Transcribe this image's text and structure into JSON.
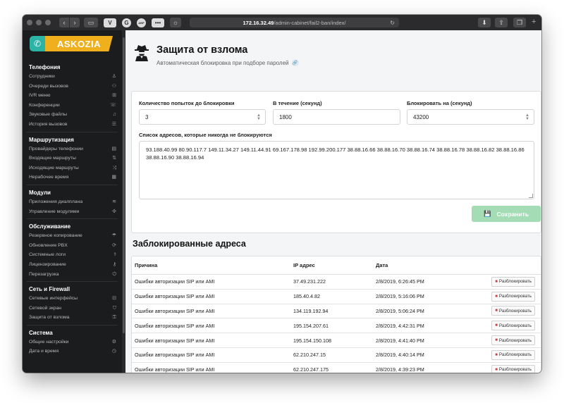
{
  "browser": {
    "url_host": "172.16.32.49",
    "url_path": "/admin-cabinet/fail2-ban/index/",
    "ext_v": "V",
    "ext_g": "G",
    "ext_abp": "ABP",
    "ext_dots": "•••"
  },
  "logo": {
    "text": "ASKOZIA"
  },
  "sidebar": {
    "sections": [
      {
        "title": "Телефония",
        "items": [
          {
            "label": "Сотрудники",
            "icon": "user-icon"
          },
          {
            "label": "Очереди вызовов",
            "icon": "users-icon"
          },
          {
            "label": "IVR меню",
            "icon": "sitemap-icon"
          },
          {
            "label": "Конференции",
            "icon": "phone-volume-icon"
          },
          {
            "label": "Звуковые файлы",
            "icon": "music-icon"
          },
          {
            "label": "История вызовов",
            "icon": "list-icon"
          }
        ]
      },
      {
        "title": "Маршрутизация",
        "items": [
          {
            "label": "Провайдеры телефонии",
            "icon": "server-icon"
          },
          {
            "label": "Входящие маршруты",
            "icon": "arrows-icon"
          },
          {
            "label": "Исходящие маршруты",
            "icon": "random-icon"
          },
          {
            "label": "Нерабочее время",
            "icon": "calendar-icon"
          }
        ]
      },
      {
        "title": "Модули",
        "items": [
          {
            "label": "Приложения диалплана",
            "icon": "code-icon"
          },
          {
            "label": "Управление модулями",
            "icon": "puzzle-icon"
          }
        ]
      },
      {
        "title": "Обслуживание",
        "items": [
          {
            "label": "Резервное копирование",
            "icon": "umbrella-icon"
          },
          {
            "label": "Обновление PBX",
            "icon": "sync-icon"
          },
          {
            "label": "Системные логи",
            "icon": "stethoscope-icon"
          },
          {
            "label": "Лицензирование",
            "icon": "key-icon"
          },
          {
            "label": "Перезагрузка",
            "icon": "power-icon"
          }
        ]
      },
      {
        "title": "Сеть и Firewall",
        "items": [
          {
            "label": "Сетевые интерфейсы",
            "icon": "network-icon"
          },
          {
            "label": "Сетевой экран",
            "icon": "shield-icon"
          },
          {
            "label": "Защита от взлома",
            "icon": "lock-icon"
          }
        ]
      },
      {
        "title": "Система",
        "items": [
          {
            "label": "Общие настройки",
            "icon": "cogs-icon"
          },
          {
            "label": "Дата и время",
            "icon": "clock-icon"
          }
        ]
      }
    ]
  },
  "header": {
    "title": "Защита от взлома",
    "subtitle": "Автоматическая блокировка при подборе паролей"
  },
  "form": {
    "attempts_label": "Количество попыток до блокировки",
    "attempts_value": "3",
    "period_label": "В течение (секунд)",
    "period_value": "1800",
    "ban_label": "Блокировать на (секунд)",
    "ban_value": "43200",
    "whitelist_label": "Список адресов, которые никогда не блокируются",
    "whitelist_value": "93.188.40.99 80.90.117.7 149.11.34.27 149.11.44.91 69.167.178.98 192.99.200.177 38.88.16.66 38.88.16.70 38.88.16.74 38.88.16.78 38.88.16.82 38.88.16.86 38.88.16.90 38.88.16.94",
    "save_label": "Сохранить"
  },
  "blocked": {
    "title": "Заблокированные адреса",
    "headers": [
      "Причина",
      "IP адрес",
      "Дата"
    ],
    "unblock_label": "Разблокировать",
    "rows": [
      {
        "reason": "Ошибки авторизации SIP или AMI",
        "ip": "37.49.231.222",
        "date": "2/8/2019, 6:26:45 PM"
      },
      {
        "reason": "Ошибки авторизации SIP или AMI",
        "ip": "185.40.4.82",
        "date": "2/8/2019, 5:16:06 PM"
      },
      {
        "reason": "Ошибки авторизации SIP или AMI",
        "ip": "134.119.192.94",
        "date": "2/8/2019, 5:06:24 PM"
      },
      {
        "reason": "Ошибки авторизации SIP или AMI",
        "ip": "195.154.207.61",
        "date": "2/8/2019, 4:42:31 PM"
      },
      {
        "reason": "Ошибки авторизации SIP или AMI",
        "ip": "195.154.150.108",
        "date": "2/8/2019, 4:41:40 PM"
      },
      {
        "reason": "Ошибки авторизации SIP или AMI",
        "ip": "62.210.247.15",
        "date": "2/8/2019, 4:40:14 PM"
      },
      {
        "reason": "Ошибки авторизации SIP или AMI",
        "ip": "62.210.247.175",
        "date": "2/8/2019, 4:39:23 PM"
      }
    ]
  }
}
